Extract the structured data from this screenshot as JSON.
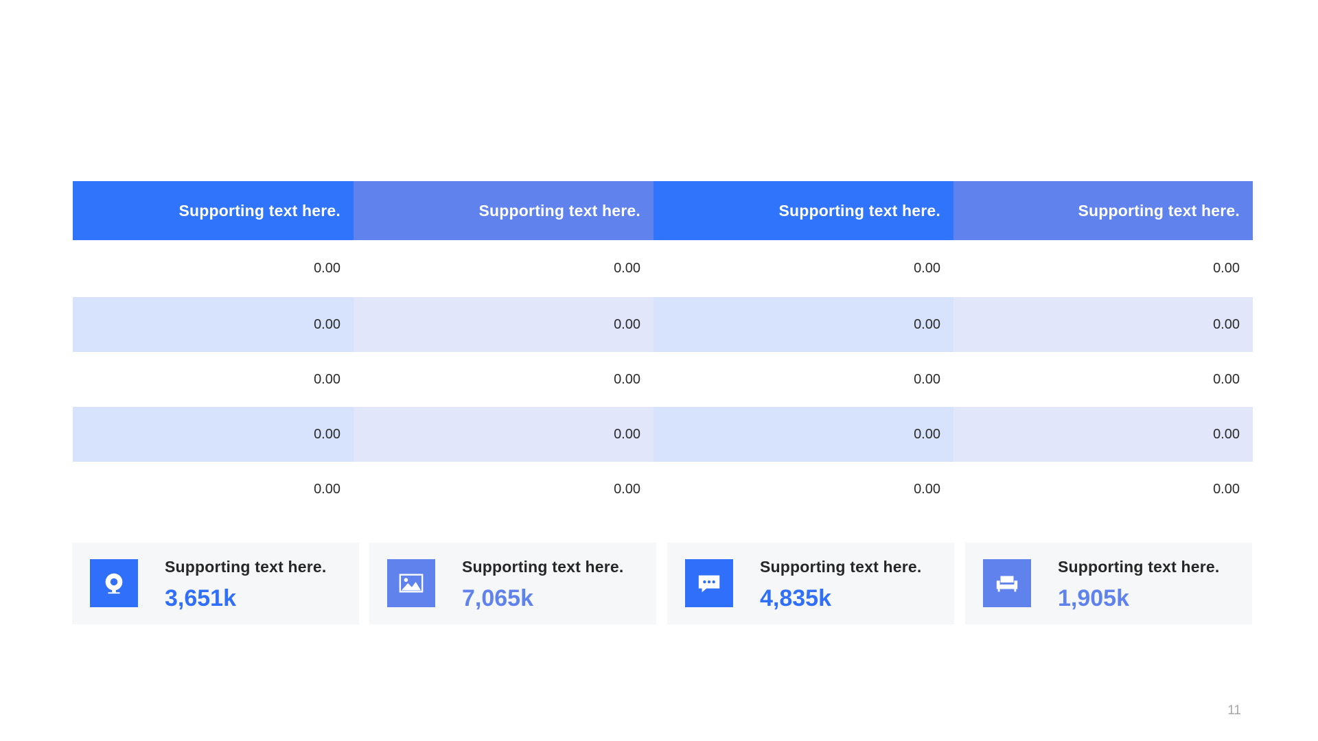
{
  "table": {
    "headers": [
      "Supporting text here.",
      "Supporting text here.",
      "Supporting text here.",
      "Supporting text here."
    ],
    "rows": [
      [
        "0.00",
        "0.00",
        "0.00",
        "0.00"
      ],
      [
        "0.00",
        "0.00",
        "0.00",
        "0.00"
      ],
      [
        "0.00",
        "0.00",
        "0.00",
        "0.00"
      ],
      [
        "0.00",
        "0.00",
        "0.00",
        "0.00"
      ],
      [
        "0.00",
        "0.00",
        "0.00",
        "0.00"
      ]
    ]
  },
  "stats": [
    {
      "label": "Supporting text here.",
      "value": "3,651k",
      "icon": "webcam-icon",
      "accent": "#2f6ffa"
    },
    {
      "label": "Supporting text here.",
      "value": "7,065k",
      "icon": "image-icon",
      "accent": "#5f82ec"
    },
    {
      "label": "Supporting text here.",
      "value": "4,835k",
      "icon": "chat-bubble-icon",
      "accent": "#2f6ffa"
    },
    {
      "label": "Supporting text here.",
      "value": "1,905k",
      "icon": "sofa-icon",
      "accent": "#5f82ec"
    }
  ],
  "colors": {
    "primary_blue": "#3074fb",
    "secondary_violet": "#5f82ec",
    "row_shade_blue": "#d7e3fd",
    "row_shade_violet": "#e1e6fa",
    "card_background": "#f6f7f9"
  },
  "page_number": "11"
}
